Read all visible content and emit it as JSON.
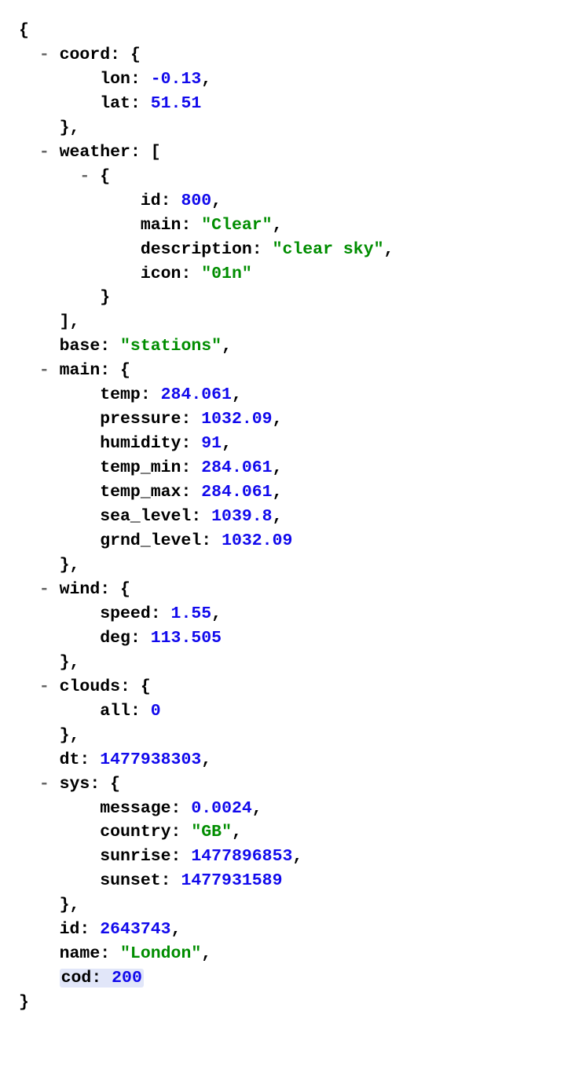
{
  "toggle": "-",
  "keys": {
    "coord": "coord",
    "lon": "lon",
    "lat": "lat",
    "weather": "weather",
    "id1": "id",
    "w_main": "main",
    "description": "description",
    "icon": "icon",
    "base": "base",
    "main": "main",
    "temp": "temp",
    "pressure": "pressure",
    "humidity": "humidity",
    "temp_min": "temp_min",
    "temp_max": "temp_max",
    "sea_level": "sea_level",
    "grnd_level": "grnd_level",
    "wind": "wind",
    "speed": "speed",
    "deg": "deg",
    "clouds": "clouds",
    "all": "all",
    "dt": "dt",
    "sys": "sys",
    "message": "message",
    "country": "country",
    "sunrise": "sunrise",
    "sunset": "sunset",
    "id2": "id",
    "name": "name",
    "cod": "cod"
  },
  "values": {
    "lon": "-0.13",
    "lat": "51.51",
    "weather_id": "800",
    "weather_main": "\"Clear\"",
    "weather_description": "\"clear sky\"",
    "weather_icon": "\"01n\"",
    "base": "\"stations\"",
    "temp": "284.061",
    "pressure": "1032.09",
    "humidity": "91",
    "temp_min": "284.061",
    "temp_max": "284.061",
    "sea_level": "1039.8",
    "grnd_level": "1032.09",
    "speed": "1.55",
    "deg": "113.505",
    "all": "0",
    "dt": "1477938303",
    "message": "0.0024",
    "country": "\"GB\"",
    "sunrise": "1477896853",
    "sunset": "1477931589",
    "id": "2643743",
    "name": "\"London\"",
    "cod": "200"
  }
}
